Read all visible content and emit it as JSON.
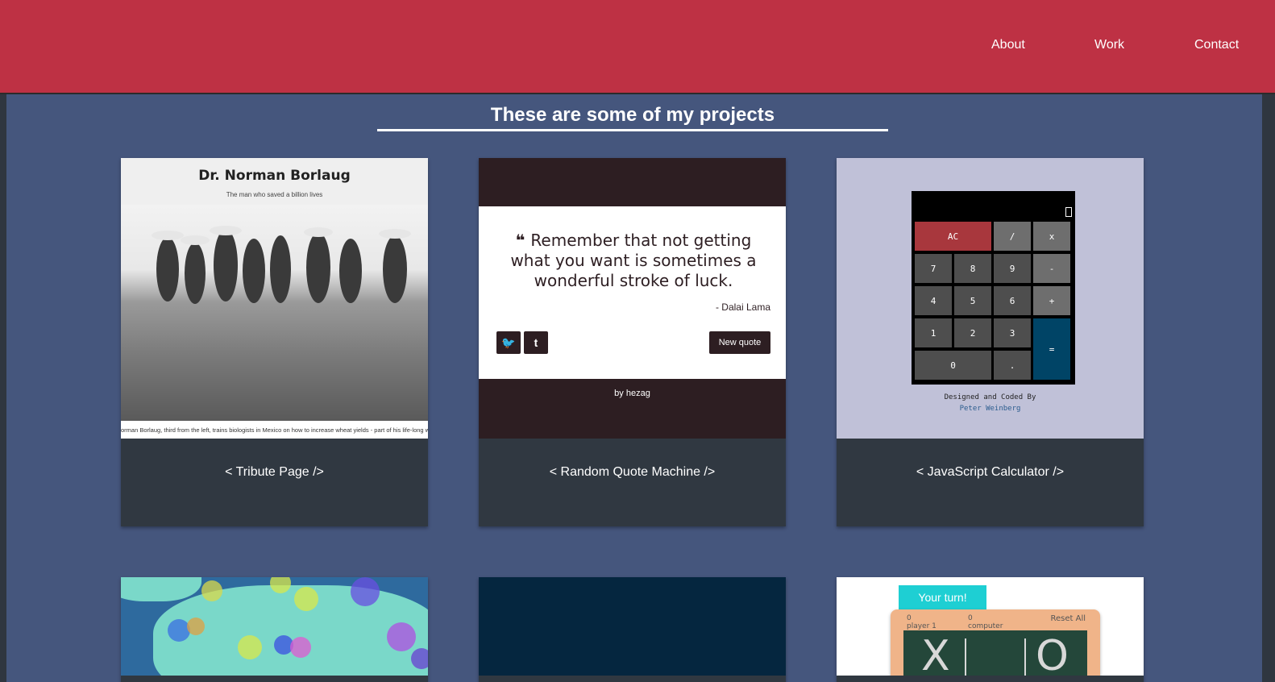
{
  "nav": {
    "about": "About",
    "work": "Work",
    "contact": "Contact"
  },
  "projects_heading": "These are some of my projects",
  "projects": [
    {
      "title": "< Tribute Page />"
    },
    {
      "title": "< Random Quote Machine />"
    },
    {
      "title": "< JavaScript Calculator />"
    }
  ],
  "tribute_preview": {
    "title": "Dr. Norman Borlaug",
    "subtitle": "The man who saved a billion lives",
    "caption": "orman Borlaug, third from the left, trains biologists in Mexico on how to increase wheat yields - part of his life-long war on hun"
  },
  "quote_preview": {
    "text": "Remember that not getting what you want is sometimes a wonderful stroke of luck.",
    "author": "- Dalai Lama",
    "twitter": "🐦",
    "tumblr": "t",
    "new_quote": "New quote",
    "byline": "by hezag"
  },
  "calc_preview": {
    "keys": {
      "ac": "AC",
      "div": "/",
      "mul": "x",
      "k7": "7",
      "k8": "8",
      "k9": "9",
      "sub": "-",
      "k4": "4",
      "k5": "5",
      "k6": "6",
      "add": "+",
      "k1": "1",
      "k2": "2",
      "k3": "3",
      "eq": "=",
      "k0": "0",
      "dot": "."
    },
    "credit": "Designed and Coded By",
    "credit_name": "Peter Weinberg"
  },
  "tictactoe_preview": {
    "turn": "Your turn!",
    "player_score": "0",
    "player_label": "player 1",
    "computer_score": "0",
    "computer_label": "computer",
    "reset": "Reset All",
    "x_mark": "X",
    "o_mark": "O"
  },
  "colors": {
    "header": "#be3144",
    "main_bg": "#45567d",
    "card_footer": "#303841"
  }
}
